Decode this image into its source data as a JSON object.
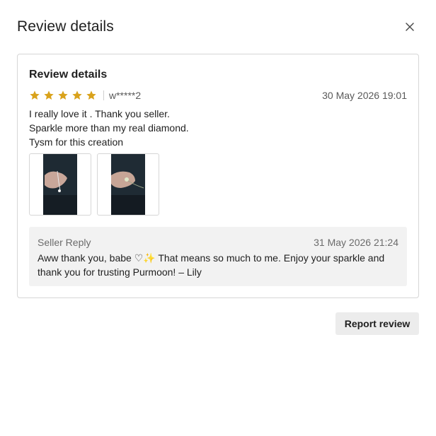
{
  "modal": {
    "title": "Review details",
    "close_icon": "close-icon"
  },
  "review": {
    "heading": "Review details",
    "rating": 5,
    "rating_max": 5,
    "star_icon": "star-icon",
    "star_color": "#d9a21b",
    "reviewer": "w*****2",
    "date": "30 May 2026 19:01",
    "text_lines": [
      "I really love it . Thank you seller.",
      "Sparkle more than my real diamond.",
      "Tysm for this creation"
    ],
    "images": [
      {
        "name": "review-photo-1"
      },
      {
        "name": "review-photo-2"
      }
    ]
  },
  "seller_reply": {
    "label": "Seller Reply",
    "date": "31 May 2026 21:24",
    "text_line_1": "Aww thank you, babe ♡✨ That means so much to me. Enjoy your sparkle and",
    "text_line_2": "thank you for trusting Purmoon! – Lily"
  },
  "actions": {
    "report_label": "Report review"
  }
}
